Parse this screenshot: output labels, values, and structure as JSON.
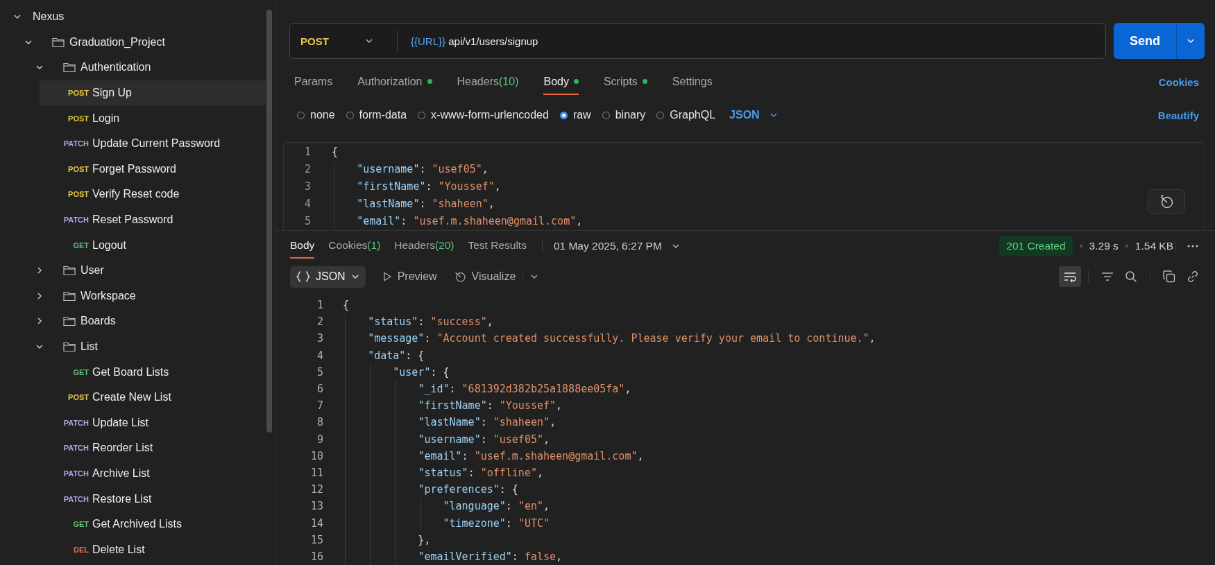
{
  "sidebar": {
    "items": [
      {
        "kind": "collection",
        "label": "Nexus",
        "expanded": true,
        "selected": false,
        "children": [
          {
            "kind": "folder",
            "label": "Graduation_Project",
            "expanded": true,
            "selected": false,
            "children": [
              {
                "kind": "folder",
                "label": "Authentication",
                "expanded": true,
                "selected": false,
                "children": [
                  {
                    "kind": "request",
                    "method": "POST",
                    "color": "#e8c547",
                    "label": "Sign Up",
                    "selected": true
                  },
                  {
                    "kind": "request",
                    "method": "POST",
                    "color": "#e8c547",
                    "label": "Login",
                    "selected": false
                  },
                  {
                    "kind": "request",
                    "method": "PATCH",
                    "color": "#b3a4e0",
                    "label": "Update Current Password",
                    "selected": false
                  },
                  {
                    "kind": "request",
                    "method": "POST",
                    "color": "#e8c547",
                    "label": "Forget Password",
                    "selected": false
                  },
                  {
                    "kind": "request",
                    "method": "POST",
                    "color": "#e8c547",
                    "label": "Verify Reset code",
                    "selected": false
                  },
                  {
                    "kind": "request",
                    "method": "PATCH",
                    "color": "#b3a4e0",
                    "label": "Reset Password",
                    "selected": false
                  },
                  {
                    "kind": "request",
                    "method": "GET",
                    "color": "#5dbf7d",
                    "label": "Logout",
                    "selected": false
                  }
                ]
              },
              {
                "kind": "folder",
                "label": "User",
                "expanded": false,
                "selected": false
              },
              {
                "kind": "folder",
                "label": "Workspace",
                "expanded": false,
                "selected": false
              },
              {
                "kind": "folder",
                "label": "Boards",
                "expanded": false,
                "selected": false
              },
              {
                "kind": "folder",
                "label": "List",
                "expanded": true,
                "selected": false,
                "children": [
                  {
                    "kind": "request",
                    "method": "GET",
                    "color": "#5dbf7d",
                    "label": "Get Board Lists",
                    "selected": false
                  },
                  {
                    "kind": "request",
                    "method": "POST",
                    "color": "#e8c547",
                    "label": "Create New List",
                    "selected": false
                  },
                  {
                    "kind": "request",
                    "method": "PATCH",
                    "color": "#b3a4e0",
                    "label": "Update List",
                    "selected": false
                  },
                  {
                    "kind": "request",
                    "method": "PATCH",
                    "color": "#b3a4e0",
                    "label": "Reorder List",
                    "selected": false
                  },
                  {
                    "kind": "request",
                    "method": "PATCH",
                    "color": "#b3a4e0",
                    "label": "Archive List",
                    "selected": false
                  },
                  {
                    "kind": "request",
                    "method": "PATCH",
                    "color": "#b3a4e0",
                    "label": "Restore List",
                    "selected": false
                  },
                  {
                    "kind": "request",
                    "method": "GET",
                    "color": "#5dbf7d",
                    "label": "Get Archived Lists",
                    "selected": false
                  },
                  {
                    "kind": "request",
                    "method": "DEL",
                    "color": "#e06c5a",
                    "label": "Delete List",
                    "selected": false
                  }
                ]
              }
            ]
          }
        ]
      }
    ]
  },
  "request": {
    "method": "POST",
    "url_variable": "{{URL}}",
    "url_path": "api/v1/users/signup",
    "send_label": "Send"
  },
  "request_tabs": [
    {
      "label": "Params",
      "selected": false,
      "dot": false
    },
    {
      "label": "Authorization",
      "selected": false,
      "dot": true
    },
    {
      "label": "Headers",
      "count": "(10)",
      "selected": false,
      "dot": false
    },
    {
      "label": "Body",
      "selected": true,
      "dot": true
    },
    {
      "label": "Scripts",
      "selected": false,
      "dot": true
    },
    {
      "label": "Settings",
      "selected": false,
      "dot": false
    }
  ],
  "cookies_link": "Cookies",
  "body_types": [
    {
      "label": "none",
      "selected": false
    },
    {
      "label": "form-data",
      "selected": false
    },
    {
      "label": "x-www-form-urlencoded",
      "selected": false
    },
    {
      "label": "raw",
      "selected": true
    },
    {
      "label": "binary",
      "selected": false
    },
    {
      "label": "GraphQL",
      "selected": false
    }
  ],
  "body_format": "JSON",
  "beautify_link": "Beautify",
  "request_body": {
    "lines": [
      {
        "number": "1",
        "text": "{"
      },
      {
        "number": "2",
        "text": "    \"username\": \"usef05\","
      },
      {
        "number": "3",
        "text": "    \"firstName\": \"Youssef\","
      },
      {
        "number": "4",
        "text": "    \"lastName\": \"shaheen\","
      },
      {
        "number": "5",
        "text": "    \"email\": \"usef.m.shaheen@gmail.com\","
      }
    ]
  },
  "response": {
    "tabs": [
      {
        "label": "Body",
        "selected": true
      },
      {
        "label": "Cookies",
        "count": "(1)",
        "selected": false
      },
      {
        "label": "Headers",
        "count": "(20)",
        "selected": false
      },
      {
        "label": "Test Results",
        "selected": false
      }
    ],
    "timestamp": "01 May 2025, 6:27 PM",
    "status": "201 Created",
    "time": "3.29 s",
    "size": "1.54 KB"
  },
  "response_view": {
    "format": "JSON",
    "preview": "Preview",
    "visualize": "Visualize",
    "wrap_selected": true
  },
  "response_body": {
    "lines": [
      {
        "number": "1",
        "text": "{"
      },
      {
        "number": "2",
        "text": "    \"status\": \"success\","
      },
      {
        "number": "3",
        "text": "    \"message\": \"Account created successfully. Please verify your email to continue.\","
      },
      {
        "number": "4",
        "text": "    \"data\": {"
      },
      {
        "number": "5",
        "text": "        \"user\": {"
      },
      {
        "number": "6",
        "text": "            \"_id\": \"681392d382b25a1888ee05fa\","
      },
      {
        "number": "7",
        "text": "            \"firstName\": \"Youssef\","
      },
      {
        "number": "8",
        "text": "            \"lastName\": \"shaheen\","
      },
      {
        "number": "9",
        "text": "            \"username\": \"usef05\","
      },
      {
        "number": "10",
        "text": "            \"email\": \"usef.m.shaheen@gmail.com\","
      },
      {
        "number": "11",
        "text": "            \"status\": \"offline\","
      },
      {
        "number": "12",
        "text": "            \"preferences\": {"
      },
      {
        "number": "13",
        "text": "                \"language\": \"en\","
      },
      {
        "number": "14",
        "text": "                \"timezone\": \"UTC\""
      },
      {
        "number": "15",
        "text": "            },"
      },
      {
        "number": "16",
        "text": "            \"emailVerified\": false,"
      }
    ]
  }
}
